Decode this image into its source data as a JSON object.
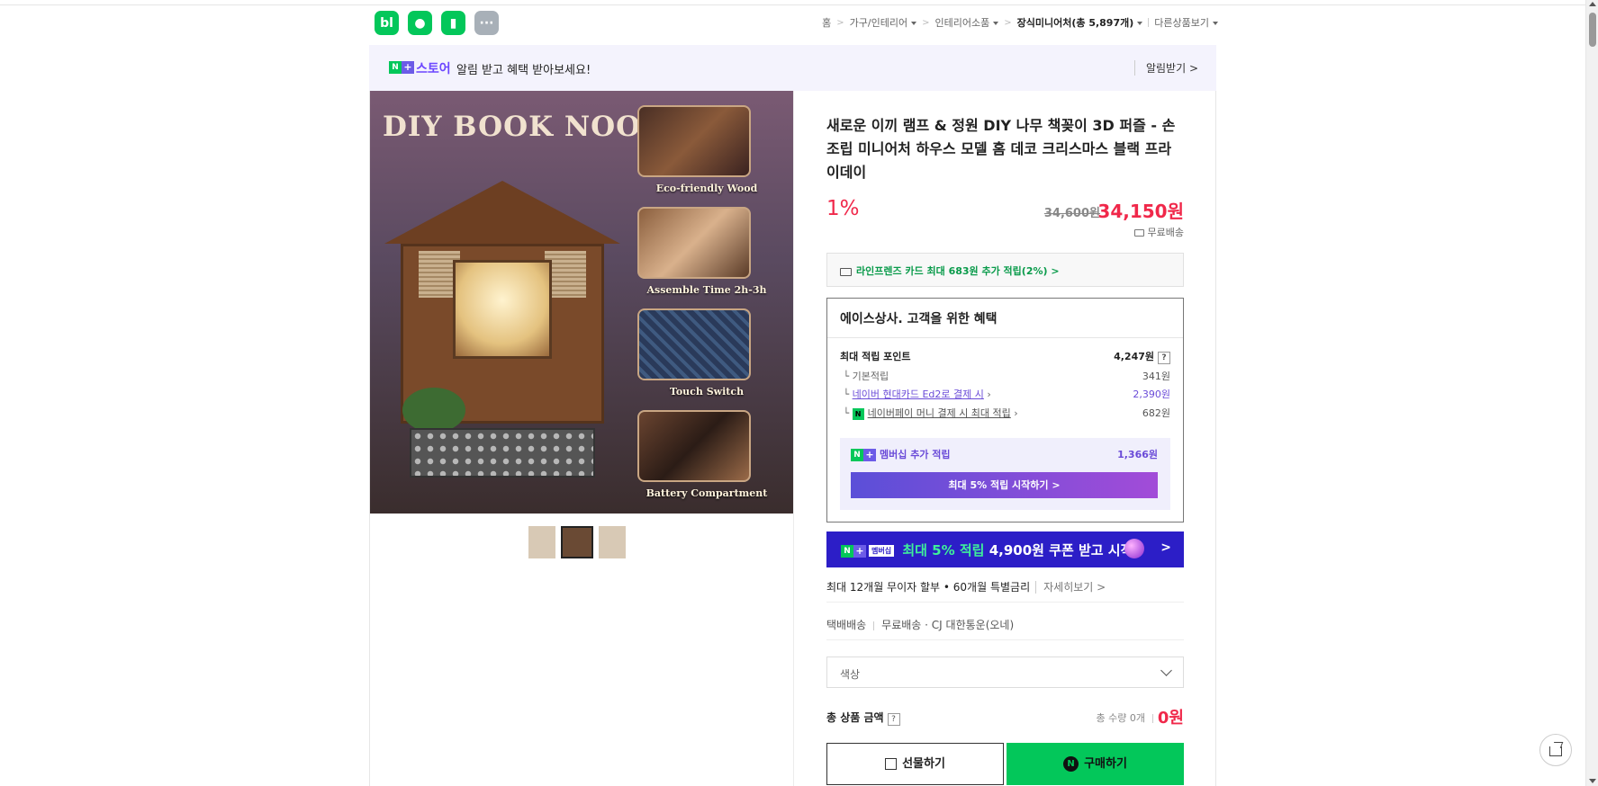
{
  "apps": [
    {
      "icon": "blog-icon",
      "label": "bl"
    },
    {
      "icon": "cafe-icon",
      "label": "●"
    },
    {
      "icon": "bookmark-icon",
      "label": "▮"
    },
    {
      "icon": "more-icon",
      "label": "···"
    }
  ],
  "breadcrumb": {
    "home": "홈",
    "cat1": "가구/인테리어",
    "cat2": "인테리어소품",
    "cat3": "장식미니어처(총 5,897개)",
    "other": "다른상품보기"
  },
  "banner": {
    "store": "스토어",
    "message": "알림 받고 혜택 받아보세요!",
    "alarm": "알림받기 >"
  },
  "hero": {
    "title": "DIY BOOK NOOK",
    "captions": [
      "Eco-friendly Wood",
      "Assemble Time 2h-3h",
      "Touch Switch",
      "Battery Compartment"
    ]
  },
  "product": {
    "title": "새로운 이끼 램프 & 정원 DIY 나무 책꽂이 3D 퍼즐 - 손 조립 미니어처 하우스 모델 홈 데코 크리스마스 블랙 프라이데이",
    "discount": "1%",
    "original_price": "34,600원",
    "price": "34,150원",
    "shipping": "무료배송"
  },
  "card_promo": "라인프렌즈 카드 최대 683원 추가 적립(2%) >",
  "benefit": {
    "heading": "에이스상사. 고객을 위한 혜택",
    "max_point_label": "최대 적립 포인트",
    "max_point_value": "4,247원",
    "basic_label": "기본적립",
    "basic_value": "341원",
    "hyundai_label": "네이버 현대카드 Ed2로 결제 시",
    "hyundai_value": "2,390원",
    "npay_label": "네이버페이 머니 결제 시 최대 적립",
    "npay_value": "682원",
    "membership_label": "멤버십 추가 적립",
    "membership_value": "1,366원",
    "membership_button": "최대 5% 적립 시작하기 >"
  },
  "coupon": {
    "badge": "멤버십",
    "highlight": "최대 5% 적립",
    "rest": "4,900원 쿠폰 받고 시작"
  },
  "installment": {
    "text": "최대 12개월 무이자 할부 • 60개월 특별금리",
    "more": "자세히보기 >"
  },
  "delivery": {
    "type": "택배배송",
    "fee": "무료배송",
    "carrier": "CJ 대한통운(오네)"
  },
  "option_select": {
    "label": "색상"
  },
  "total": {
    "label": "총 상품 금액",
    "qty": "총 수량 0개",
    "price": "0원"
  },
  "actions": {
    "gift": "선물하기",
    "buy": "구매하기"
  },
  "colors": {
    "naver_green": "#03c75a",
    "price_red": "#f0284a",
    "membership_purple": "#6a4bd8",
    "coupon_blue": "#2c1ec7"
  }
}
